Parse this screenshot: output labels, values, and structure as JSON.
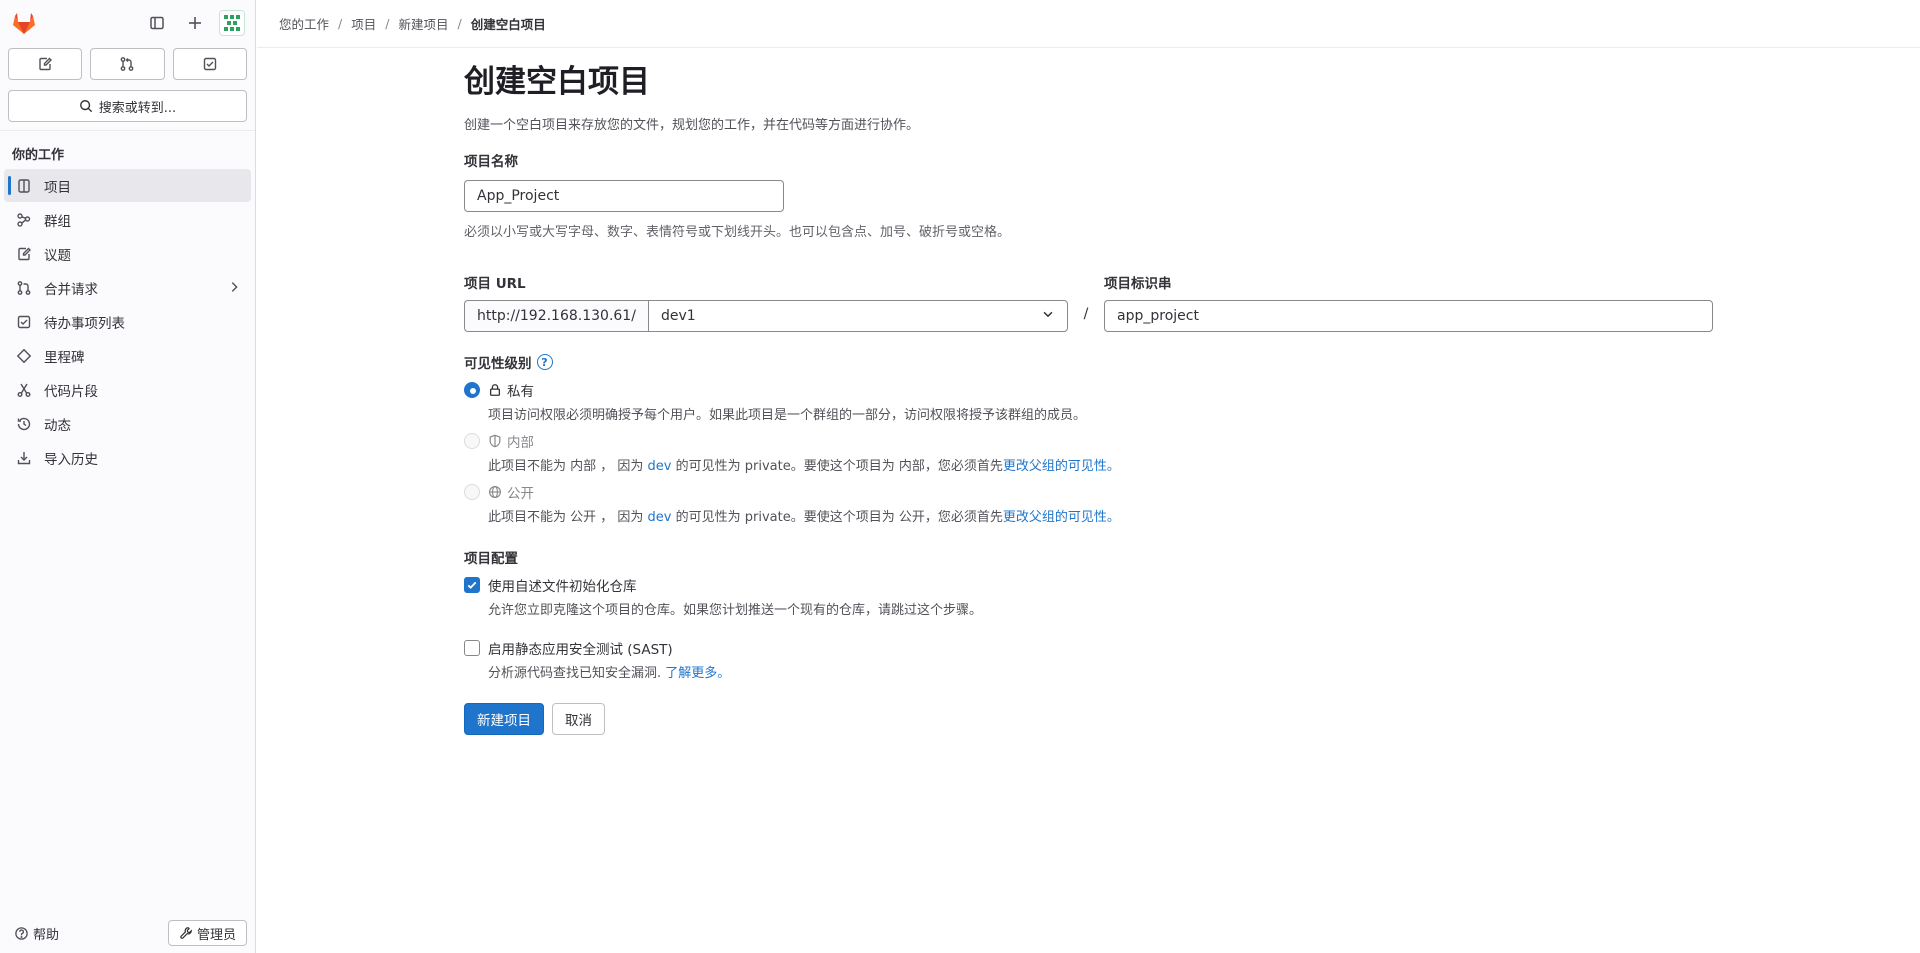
{
  "sidebar": {
    "section_title": "你的工作",
    "search_label": "搜索或转到...",
    "items": [
      {
        "label": "项目",
        "icon": "project-icon"
      },
      {
        "label": "群组",
        "icon": "group-icon"
      },
      {
        "label": "议题",
        "icon": "issues-icon"
      },
      {
        "label": "合并请求",
        "icon": "merge-request-icon"
      },
      {
        "label": "待办事项列表",
        "icon": "todo-icon"
      },
      {
        "label": "里程碑",
        "icon": "milestone-icon"
      },
      {
        "label": "代码片段",
        "icon": "snippet-icon"
      },
      {
        "label": "动态",
        "icon": "history-icon"
      },
      {
        "label": "导入历史",
        "icon": "import-icon"
      }
    ],
    "help_label": "帮助",
    "admin_label": "管理员"
  },
  "breadcrumb": [
    "您的工作",
    "项目",
    "新建项目",
    "创建空白项目"
  ],
  "page": {
    "title": "创建空白项目",
    "description": "创建一个空白项目来存放您的文件，规划您的工作，并在代码等方面进行协作。"
  },
  "form": {
    "name_label": "项目名称",
    "name_value": "App_Project",
    "name_help": "必须以小写或大写字母、数字、表情符号或下划线开头。也可以包含点、加号、破折号或空格。",
    "url_label": "项目 URL",
    "url_prefix": "http://192.168.130.61/",
    "url_namespace": "dev1",
    "slug_label": "项目标识串",
    "slug_value": "app_project",
    "visibility_label": "可见性级别",
    "visibility": {
      "private_label": "私有",
      "private_help": "项目访问权限必须明确授予每个用户。如果此项目是一个群组的一部分，访问权限将授予该群组的成员。",
      "internal_label": "内部",
      "internal_help_pre": "此项目不能为 内部 ， 因为 ",
      "internal_help_group": "dev",
      "internal_help_mid": " 的可见性为 private。要使这个项目为 内部，您必须首先",
      "internal_help_link": "更改父组的可见性",
      "internal_help_end": "。",
      "public_label": "公开",
      "public_help_pre": "此项目不能为 公开 ， 因为 ",
      "public_help_group": "dev",
      "public_help_mid": " 的可见性为 private。要使这个项目为 公开，您必须首先",
      "public_help_link": "更改父组的可见性",
      "public_help_end": "。"
    },
    "config_label": "项目配置",
    "readme_label": "使用自述文件初始化仓库",
    "readme_help": "允许您立即克隆这个项目的仓库。如果您计划推送一个现有的仓库，请跳过这个步骤。",
    "readme_checked": true,
    "sast_label": "启用静态应用安全测试 (SAST)",
    "sast_help_pre": "分析源代码查找已知安全漏洞. ",
    "sast_help_link": "了解更多",
    "sast_help_end": "。",
    "sast_checked": false,
    "submit_label": "新建项目",
    "cancel_label": "取消"
  },
  "colors": {
    "accent": "#1f75cb",
    "logo": "#e24329"
  }
}
